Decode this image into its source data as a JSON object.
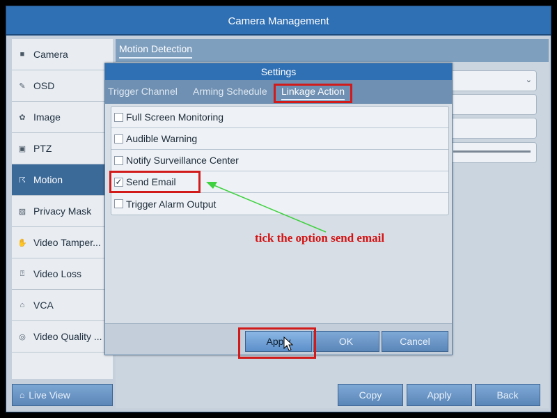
{
  "window": {
    "title": "Camera Management"
  },
  "sidebar": {
    "items": [
      {
        "label": "Camera",
        "icon": "camera-icon"
      },
      {
        "label": "OSD",
        "icon": "osd-icon"
      },
      {
        "label": "Image",
        "icon": "image-icon"
      },
      {
        "label": "PTZ",
        "icon": "ptz-icon"
      },
      {
        "label": "Motion",
        "icon": "motion-icon",
        "active": true
      },
      {
        "label": "Privacy Mask",
        "icon": "privacy-mask-icon"
      },
      {
        "label": "Video Tamper...",
        "icon": "video-tamper-icon"
      },
      {
        "label": "Video Loss",
        "icon": "video-loss-icon"
      },
      {
        "label": "VCA",
        "icon": "vca-icon"
      },
      {
        "label": "Video Quality ...",
        "icon": "video-quality-icon"
      }
    ],
    "live_view": "Live View"
  },
  "main": {
    "tab": "Motion Detection",
    "buttons": {
      "copy": "Copy",
      "apply": "Apply",
      "back": "Back"
    }
  },
  "dialog": {
    "title": "Settings",
    "tabs": [
      "Trigger Channel",
      "Arming Schedule",
      "Linkage Action"
    ],
    "active_tab": "Linkage Action",
    "options": [
      {
        "label": "Full Screen Monitoring",
        "checked": false
      },
      {
        "label": "Audible Warning",
        "checked": false
      },
      {
        "label": "Notify Surveillance Center",
        "checked": false
      },
      {
        "label": "Send Email",
        "checked": true
      },
      {
        "label": "Trigger Alarm Output",
        "checked": false
      }
    ],
    "buttons": {
      "apply": "Apply",
      "ok": "OK",
      "cancel": "Cancel"
    }
  },
  "annotation": {
    "text": "tick the option send email",
    "color": "#d31313",
    "arrow_color": "#3fd13f"
  },
  "colors": {
    "titlebar": "#2f6fb3",
    "sidebar_active": "#3b6998",
    "highlight": "#d11a1a"
  }
}
